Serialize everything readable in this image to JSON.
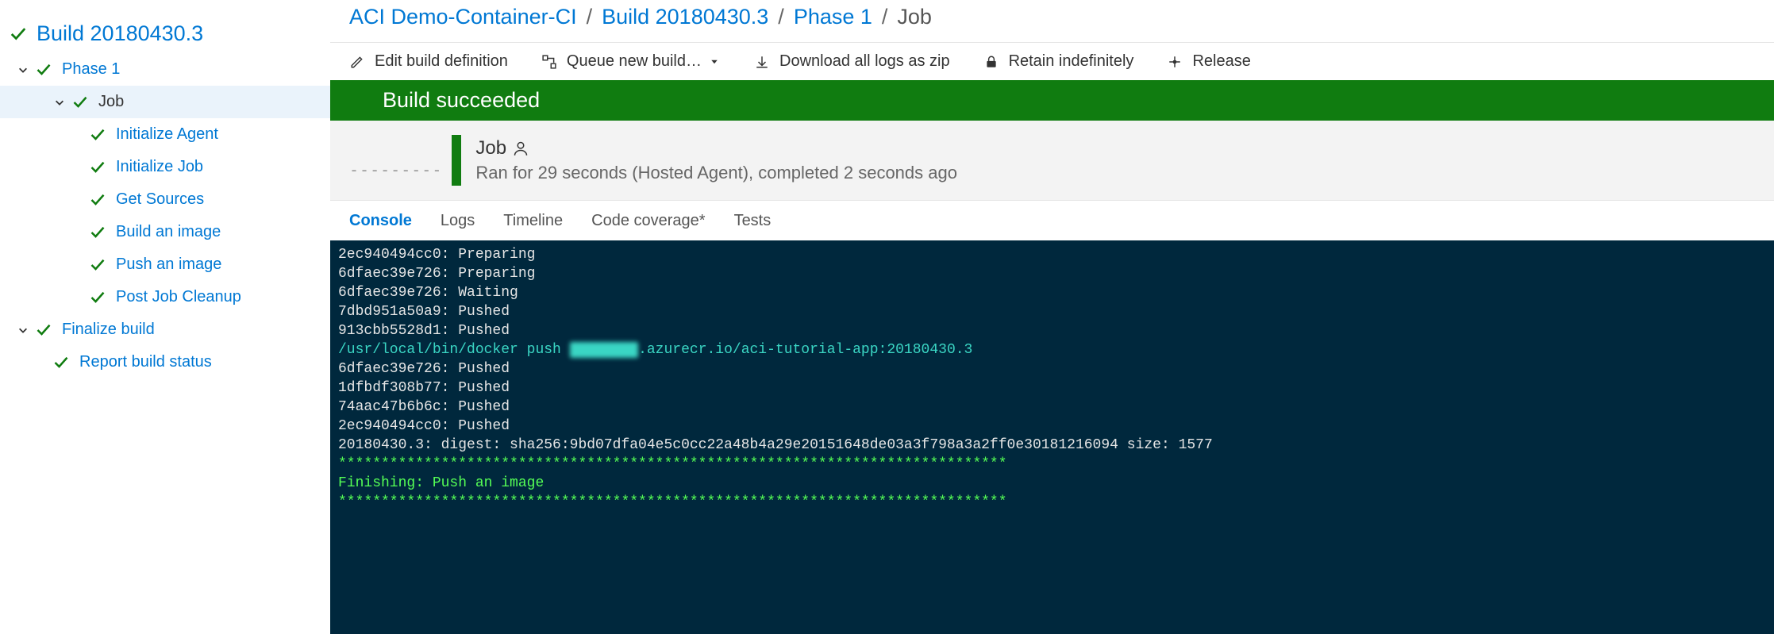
{
  "sidebar": {
    "build": "Build 20180430.3",
    "phase1": "Phase 1",
    "job": "Job",
    "steps": [
      "Initialize Agent",
      "Initialize Job",
      "Get Sources",
      "Build an image",
      "Push an image",
      "Post Job Cleanup"
    ],
    "finalize": "Finalize build",
    "report": "Report build status"
  },
  "breadcrumb": {
    "project": "ACI Demo-Container-CI",
    "build": "Build 20180430.3",
    "phase": "Phase 1",
    "job": "Job"
  },
  "toolbar": {
    "edit": "Edit build definition",
    "queue": "Queue new build…",
    "download": "Download all logs as zip",
    "retain": "Retain indefinitely",
    "release": "Release"
  },
  "banner": "Build succeeded",
  "jobHeader": {
    "dashes": "---------",
    "title": "Job",
    "subtitle": "Ran for 29 seconds (Hosted Agent), completed 2 seconds ago"
  },
  "tabs": {
    "console": "Console",
    "logs": "Logs",
    "timeline": "Timeline",
    "coverage": "Code coverage*",
    "tests": "Tests"
  },
  "console": {
    "l0": "2ec940494cc0: Preparing",
    "l1": "6dfaec39e726: Preparing",
    "l2": "6dfaec39e726: Waiting",
    "l3": "7dbd951a50a9: Pushed",
    "l4": "913cbb5528d1: Pushed",
    "push_cmd_pre": "/usr/local/bin/docker push ",
    "push_redact": "xxxxxxxx",
    "push_cmd_post": ".azurecr.io/aci-tutorial-app:20180430.3",
    "l6": "6dfaec39e726: Pushed",
    "l7": "1dfbdf308b77: Pushed",
    "l8": "74aac47b6b6c: Pushed",
    "l9": "2ec940494cc0: Pushed",
    "l10": "20180430.3: digest: sha256:9bd07dfa04e5c0cc22a48b4a29e20151648de03a3f798a3a2ff0e30181216094 size: 1577",
    "stars": "******************************************************************************",
    "finishing": "Finishing: Push an image"
  }
}
